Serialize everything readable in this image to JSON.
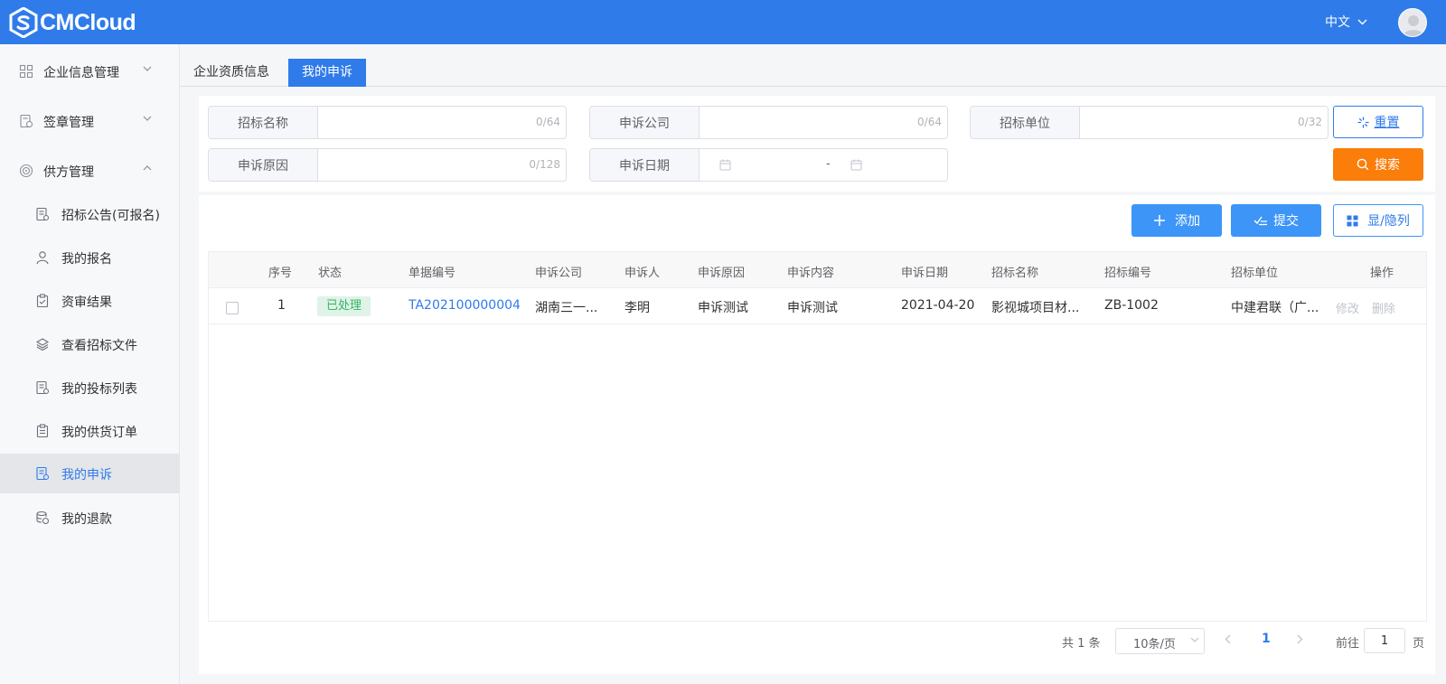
{
  "header": {
    "logo_text": "CMCloud",
    "language": "中文"
  },
  "sidebar": {
    "groups": [
      {
        "label": "企业信息管理"
      },
      {
        "label": "签章管理"
      },
      {
        "label": "供方管理"
      }
    ],
    "sub_items": [
      {
        "label": "招标公告(可报名)"
      },
      {
        "label": "我的报名"
      },
      {
        "label": "资审结果"
      },
      {
        "label": "查看招标文件"
      },
      {
        "label": "我的投标列表"
      },
      {
        "label": "我的供货订单"
      },
      {
        "label": "我的申诉"
      },
      {
        "label": "我的退款"
      }
    ],
    "active_item": "我的申诉"
  },
  "tabs": [
    {
      "label": "企业资质信息"
    },
    {
      "label": "我的申诉"
    }
  ],
  "filters": {
    "bid_name": {
      "label": "招标名称",
      "value": "",
      "count": "0/64"
    },
    "complaint_company": {
      "label": "申诉公司",
      "value": "",
      "count": "0/64"
    },
    "bid_unit": {
      "label": "招标单位",
      "value": "",
      "count": "0/32"
    },
    "complaint_reason": {
      "label": "申诉原因",
      "value": "",
      "count": "0/128"
    },
    "complaint_date": {
      "label": "申诉日期",
      "separator": "-"
    }
  },
  "buttons": {
    "reset": "重置",
    "search": "搜索",
    "add": "添加",
    "submit": "提交",
    "toggle_columns": "显/隐列"
  },
  "table": {
    "columns": [
      "序号",
      "状态",
      "单据编号",
      "申诉公司",
      "申诉人",
      "申诉原因",
      "申诉内容",
      "申诉日期",
      "招标名称",
      "招标编号",
      "招标单位",
      "操作"
    ],
    "rows": [
      {
        "index": "1",
        "status": "已处理",
        "doc_no": "TA202100000004",
        "company": "湖南三一...",
        "person": "李明",
        "reason": "申诉测试",
        "content": "申诉测试",
        "date": "2021-04-20",
        "bid_name": "影视城项目材...",
        "bid_no": "ZB-1002",
        "bid_unit": "中建君联（广...",
        "edit": "修改",
        "delete": "删除"
      }
    ]
  },
  "pagination": {
    "total": "共 1 条",
    "page_size": "10条/页",
    "current_page": "1",
    "goto_label": "前往",
    "goto_value": "1",
    "page_suffix": "页"
  },
  "colors": {
    "primary": "#2f7bea",
    "search": "#fb7d0a",
    "action": "#3d95f7",
    "status_bg": "#dff3e7",
    "status_text": "#35b567"
  }
}
